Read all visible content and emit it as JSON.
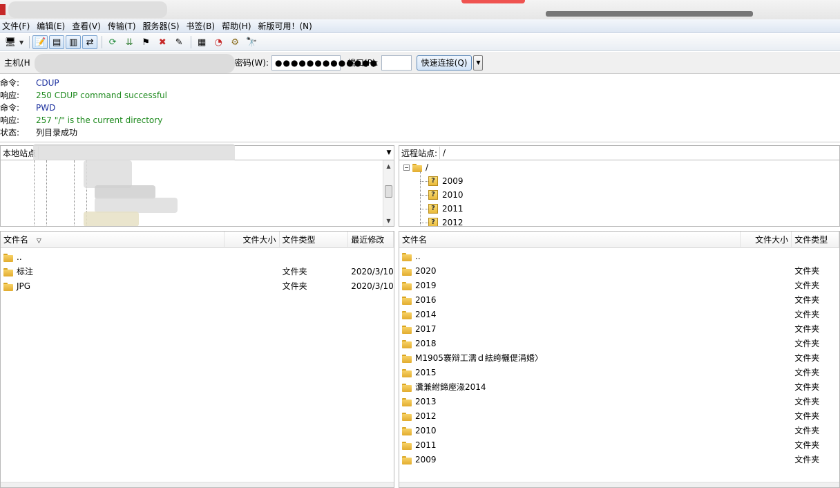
{
  "menu": [
    "文件(F)",
    "编辑(E)",
    "查看(V)",
    "传输(T)",
    "服务器(S)",
    "书签(B)",
    "帮助(H)",
    "新版可用！(N)"
  ],
  "toolbar_icons": [
    "site-manager-icon",
    "dropdown-icon",
    "toggle-log-icon",
    "toggle-local-tree-icon",
    "toggle-remote-tree-icon",
    "toggle-queue-icon",
    "refresh-icon",
    "process-queue-icon",
    "cancel-icon",
    "disconnect-icon",
    "reconnect-icon",
    "filter-icon",
    "compare-icon",
    "sync-browse-icon",
    "search-icon"
  ],
  "quickconnect": {
    "host_label": "主机(H",
    "password_label": "密码(W):",
    "password_dots": "●●●●●●●●●●●●●",
    "port_label": "端口(P):",
    "port_value": "",
    "connect_label": "快速连接(Q)"
  },
  "log": [
    {
      "type": "命令:",
      "text": "CDUP",
      "kind": "cmd"
    },
    {
      "type": "响应:",
      "text": "250 CDUP command successful",
      "kind": "resp"
    },
    {
      "type": "命令:",
      "text": "PWD",
      "kind": "cmd"
    },
    {
      "type": "响应:",
      "text": "257 \"/\" is the current directory",
      "kind": "resp"
    },
    {
      "type": "状态:",
      "text": "列目录成功",
      "kind": "stat"
    }
  ],
  "local": {
    "site_label": "本地站点",
    "columns": [
      "文件名",
      "文件大小",
      "文件类型",
      "最近修改"
    ],
    "sort_indicator": "▽",
    "files": [
      {
        "name": "..",
        "size": "",
        "type": "",
        "modified": ""
      },
      {
        "name": "标注",
        "size": "",
        "type": "文件夹",
        "modified": "2020/3/10"
      },
      {
        "name": "JPG",
        "size": "",
        "type": "文件夹",
        "modified": "2020/3/10"
      }
    ]
  },
  "remote": {
    "site_label": "远程站点:",
    "path": "/",
    "tree_root": "/",
    "tree_items": [
      "2009",
      "2010",
      "2011",
      "2012"
    ],
    "columns": [
      "文件名",
      "文件大小",
      "文件类型"
    ],
    "files": [
      {
        "name": "..",
        "type": ""
      },
      {
        "name": "2020",
        "type": "文件夹"
      },
      {
        "name": "2019",
        "type": "文件夹"
      },
      {
        "name": "2016",
        "type": "文件夹"
      },
      {
        "name": "2014",
        "type": "文件夹"
      },
      {
        "name": "2017",
        "type": "文件夹"
      },
      {
        "name": "2018",
        "type": "文件夹"
      },
      {
        "name": "M1905褰辩工濡ｄ紶绔欐偍涓婚〉",
        "type": "文件夹"
      },
      {
        "name": "2015",
        "type": "文件夹"
      },
      {
        "name": "瀵兼紨鍗庢湪2014",
        "type": "文件夹"
      },
      {
        "name": "2013",
        "type": "文件夹"
      },
      {
        "name": "2012",
        "type": "文件夹"
      },
      {
        "name": "2010",
        "type": "文件夹"
      },
      {
        "name": "2011",
        "type": "文件夹"
      },
      {
        "name": "2009",
        "type": "文件夹"
      }
    ]
  }
}
